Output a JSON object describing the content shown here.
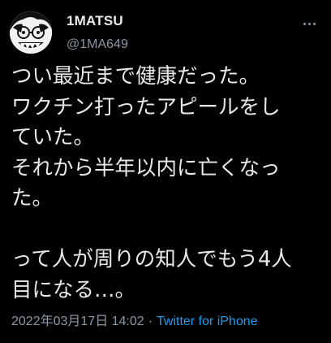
{
  "tweet": {
    "display_name": "1MATSU",
    "handle": "@1MA649",
    "lines": [
      "つい最近まで健康だった。",
      "ワクチン打ったアピールをし",
      "ていた。",
      "それから半年以内に亡くなっ",
      "た。",
      "",
      "って人が周りの知人でもう4人",
      "目になる…。"
    ],
    "timestamp": "2022年03月17日 14:02",
    "separator": "·",
    "source": "Twitter for iPhone"
  },
  "icons": {
    "avatar": "manga-face-avatar",
    "more": "more-options-icon"
  },
  "colors": {
    "background": "#000000",
    "text": "#e7e9ea",
    "secondary": "#8b98a5",
    "link": "#1d9bf0"
  }
}
